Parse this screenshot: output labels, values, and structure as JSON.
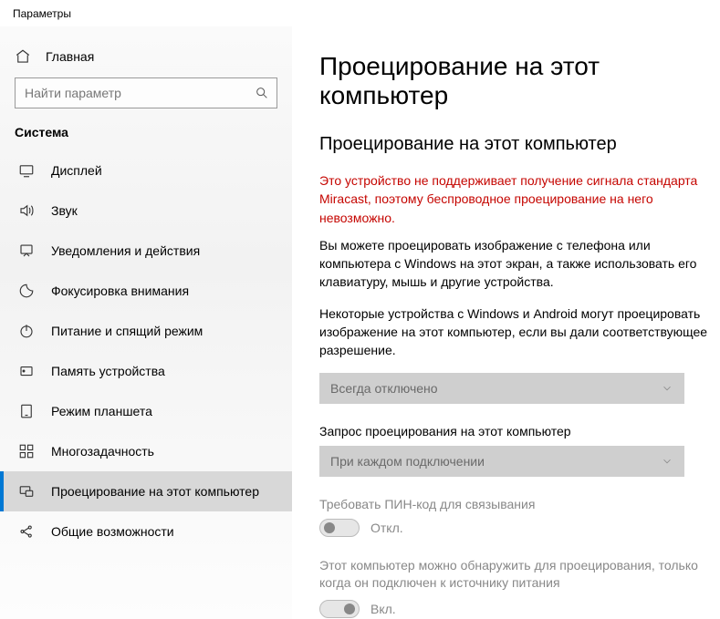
{
  "window": {
    "title": "Параметры"
  },
  "sidebar": {
    "home": "Главная",
    "search_placeholder": "Найти параметр",
    "section": "Система",
    "items": [
      {
        "label": "Дисплей",
        "icon": "display-icon"
      },
      {
        "label": "Звук",
        "icon": "sound-icon"
      },
      {
        "label": "Уведомления и действия",
        "icon": "notifications-icon"
      },
      {
        "label": "Фокусировка внимания",
        "icon": "focus-icon"
      },
      {
        "label": "Питание и спящий режим",
        "icon": "power-icon"
      },
      {
        "label": "Память устройства",
        "icon": "storage-icon"
      },
      {
        "label": "Режим планшета",
        "icon": "tablet-icon"
      },
      {
        "label": "Многозадачность",
        "icon": "multitask-icon"
      },
      {
        "label": "Проецирование на этот компьютер",
        "icon": "project-icon"
      },
      {
        "label": "Общие возможности",
        "icon": "share-icon"
      }
    ],
    "active_index": 8
  },
  "content": {
    "page_title": "Проецирование на этот компьютер",
    "section_title": "Проецирование на этот компьютер",
    "warning": "Это устройство не поддерживает получение сигнала стандарта Miracast, поэтому беспроводное проецирование на него невозможно.",
    "para1": "Вы можете проецировать изображение с телефона или компьютера с Windows на этот экран, а также использовать его клавиатуру, мышь и другие устройства.",
    "para2": "Некоторые устройства с Windows и Android могут проецировать изображение на этот компьютер, если вы дали соответствующее разрешение.",
    "dropdown1_value": "Всегда отключено",
    "field2_label": "Запрос проецирования на этот компьютер",
    "dropdown2_value": "При каждом подключении",
    "field3_label": "Требовать ПИН-код для связывания",
    "toggle3_text": "Откл.",
    "field4_label": "Этот компьютер можно обнаружить для проецирования, только когда он подключен к источнику питания",
    "toggle4_text": "Вкл."
  }
}
